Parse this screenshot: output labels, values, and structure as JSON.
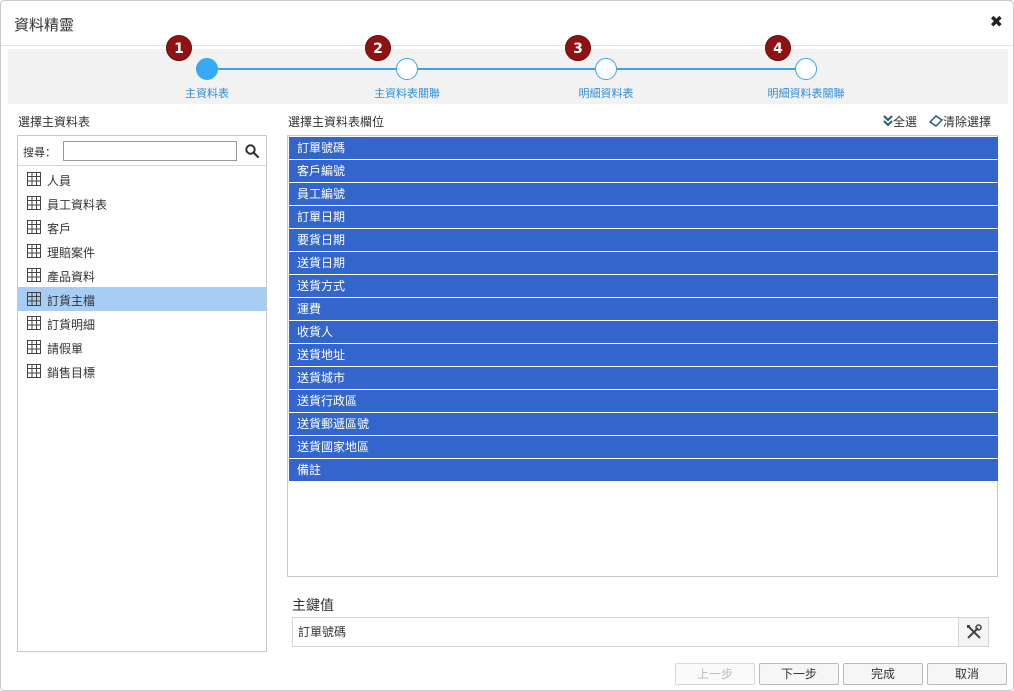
{
  "dialog": {
    "title": "資料精靈",
    "close_glyph": "✖"
  },
  "steps": [
    {
      "number": "1",
      "label": "主資料表",
      "active": true
    },
    {
      "number": "2",
      "label": "主資料表關聯",
      "active": false
    },
    {
      "number": "3",
      "label": "明細資料表",
      "active": false
    },
    {
      "number": "4",
      "label": "明細資料表關聯",
      "active": false
    }
  ],
  "left": {
    "section_label": "選擇主資料表",
    "search_label": "搜尋：",
    "search_value": "",
    "tables": [
      {
        "label": "人員",
        "selected": false
      },
      {
        "label": "員工資料表",
        "selected": false
      },
      {
        "label": "客戶",
        "selected": false
      },
      {
        "label": "理賠案件",
        "selected": false
      },
      {
        "label": "產品資料",
        "selected": false
      },
      {
        "label": "訂貨主檔",
        "selected": true
      },
      {
        "label": "訂貨明細",
        "selected": false
      },
      {
        "label": "請假單",
        "selected": false
      },
      {
        "label": "銷售目標",
        "selected": false
      }
    ]
  },
  "right": {
    "section_label": "選擇主資料表欄位",
    "select_all_label": "全選",
    "clear_label": "清除選擇",
    "fields": [
      "訂單號碼",
      "客戶編號",
      "員工編號",
      "訂單日期",
      "要貨日期",
      "送貨日期",
      "送貨方式",
      "運費",
      "收貨人",
      "送貨地址",
      "送貨城市",
      "送貨行政區",
      "送貨郵遞區號",
      "送貨國家地區",
      "備註"
    ]
  },
  "primary_key": {
    "label": "主鍵值",
    "value": "訂單號碼"
  },
  "buttons": {
    "prev": "上一步",
    "next": "下一步",
    "finish": "完成",
    "cancel": "取消"
  },
  "colors": {
    "accent": "#3ba3e8",
    "selected_field": "#3366cc",
    "selected_table": "#a7cdf5",
    "badge": "#8f1313"
  }
}
